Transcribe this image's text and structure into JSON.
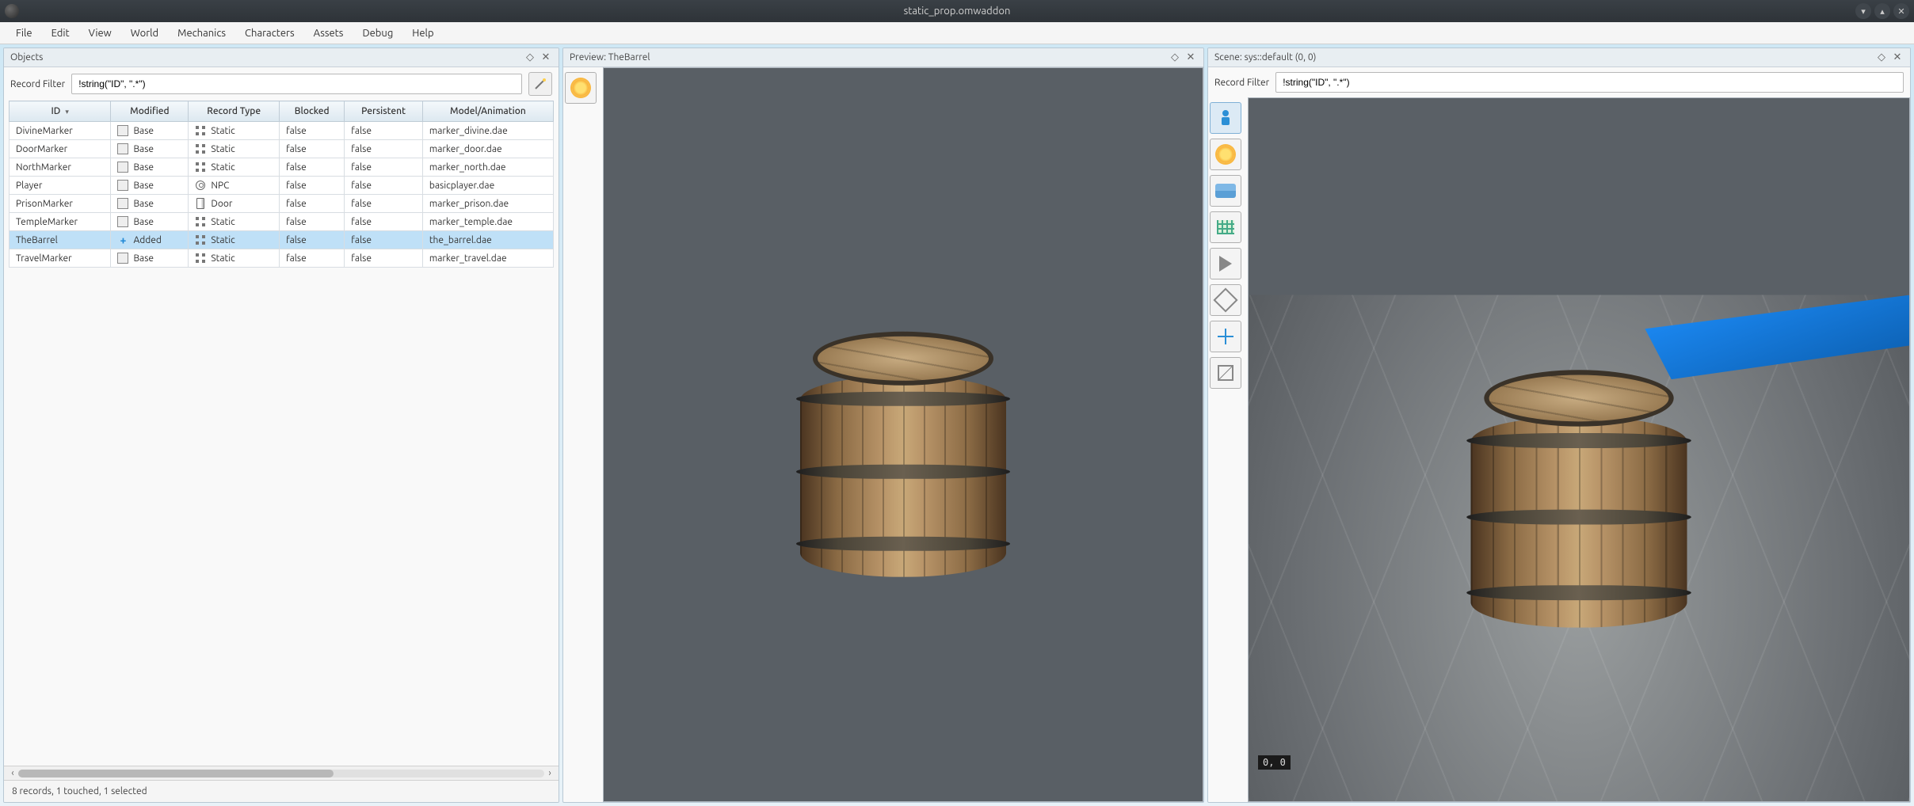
{
  "window": {
    "title": "static_prop.omwaddon"
  },
  "menubar": [
    "File",
    "Edit",
    "View",
    "World",
    "Mechanics",
    "Characters",
    "Assets",
    "Debug",
    "Help"
  ],
  "panels": {
    "objects": {
      "title": "Objects",
      "filter_label": "Record Filter",
      "filter_value": "!string(\"ID\", \".*\")",
      "columns": [
        "ID",
        "Modified",
        "Record Type",
        "Blocked",
        "Persistent",
        "Model/Animation"
      ],
      "rows": [
        {
          "id": "DivineMarker",
          "modified": "Base",
          "mod_icon": "base",
          "record_type": "Static",
          "rt_icon": "grid",
          "blocked": "false",
          "persistent": "false",
          "model": "marker_divine.dae",
          "selected": false
        },
        {
          "id": "DoorMarker",
          "modified": "Base",
          "mod_icon": "base",
          "record_type": "Static",
          "rt_icon": "grid",
          "blocked": "false",
          "persistent": "false",
          "model": "marker_door.dae",
          "selected": false
        },
        {
          "id": "NorthMarker",
          "modified": "Base",
          "mod_icon": "base",
          "record_type": "Static",
          "rt_icon": "grid",
          "blocked": "false",
          "persistent": "false",
          "model": "marker_north.dae",
          "selected": false
        },
        {
          "id": "Player",
          "modified": "Base",
          "mod_icon": "base",
          "record_type": "NPC",
          "rt_icon": "npc",
          "blocked": "false",
          "persistent": "false",
          "model": "basicplayer.dae",
          "selected": false
        },
        {
          "id": "PrisonMarker",
          "modified": "Base",
          "mod_icon": "base",
          "record_type": "Door",
          "rt_icon": "door",
          "blocked": "false",
          "persistent": "false",
          "model": "marker_prison.dae",
          "selected": false
        },
        {
          "id": "TempleMarker",
          "modified": "Base",
          "mod_icon": "base",
          "record_type": "Static",
          "rt_icon": "grid",
          "blocked": "false",
          "persistent": "false",
          "model": "marker_temple.dae",
          "selected": false
        },
        {
          "id": "TheBarrel",
          "modified": "Added",
          "mod_icon": "plus",
          "record_type": "Static",
          "rt_icon": "grid",
          "blocked": "false",
          "persistent": "false",
          "model": "the_barrel.dae",
          "selected": true
        },
        {
          "id": "TravelMarker",
          "modified": "Base",
          "mod_icon": "base",
          "record_type": "Static",
          "rt_icon": "grid",
          "blocked": "false",
          "persistent": "false",
          "model": "marker_travel.dae",
          "selected": false
        }
      ],
      "status": "8 records, 1 touched, 1 selected"
    },
    "preview": {
      "title": "Preview: TheBarrel"
    },
    "scene": {
      "title": "Scene: sys::default (0, 0)",
      "filter_label": "Record Filter",
      "filter_value": "!string(\"ID\", \".*\")",
      "coord_label": "0, 0"
    }
  },
  "scene_tools": [
    {
      "name": "camera-mode",
      "icon": "person",
      "active": true
    },
    {
      "name": "lighting",
      "icon": "sun",
      "active": false
    },
    {
      "name": "water",
      "icon": "water",
      "active": false
    },
    {
      "name": "pathgrid",
      "icon": "grid",
      "active": false
    },
    {
      "name": "run",
      "icon": "play",
      "active": false
    },
    {
      "name": "random",
      "icon": "d20",
      "active": false
    },
    {
      "name": "move",
      "icon": "move",
      "active": false
    },
    {
      "name": "select-box",
      "icon": "cube",
      "active": false
    }
  ]
}
